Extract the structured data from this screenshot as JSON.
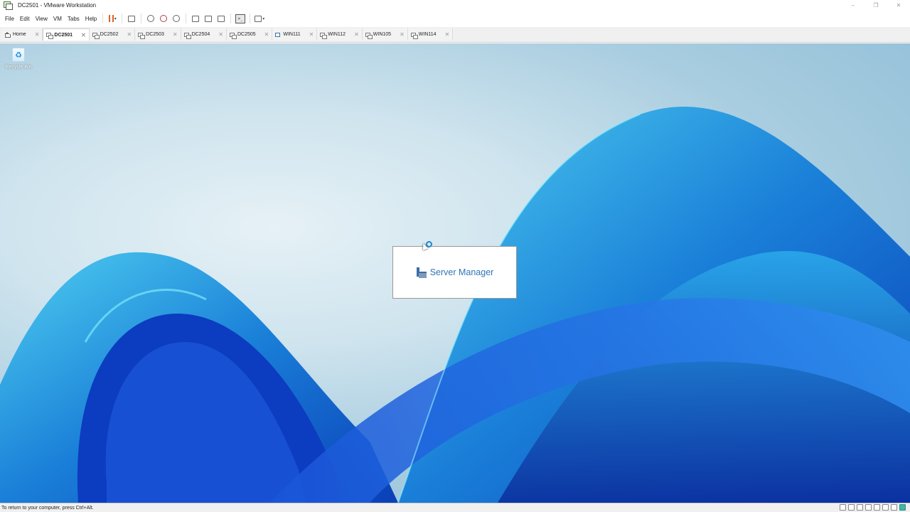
{
  "window": {
    "title": "DC2501 - VMware Workstation",
    "controls": [
      "–",
      "❐",
      "✕"
    ]
  },
  "menu": {
    "items": [
      "File",
      "Edit",
      "View",
      "VM",
      "Tabs",
      "Help"
    ]
  },
  "toolbar": {
    "icons": [
      "pause-icon",
      "send-keys-icon",
      "snapshot-icon",
      "revert-snapshot-icon",
      "snapshot-manager-icon",
      "library-icon",
      "thumbnail-icon",
      "fullscreen-icon",
      "console-view-icon",
      "stretch-icon"
    ],
    "console_glyph": ">_",
    "caret": "▾"
  },
  "tabs": [
    {
      "label": "Home",
      "icon": "home-icon",
      "active": false
    },
    {
      "label": "DC2501",
      "icon": "vm-icon",
      "active": true
    },
    {
      "label": "DC2502",
      "icon": "vm-icon",
      "active": false
    },
    {
      "label": "DC2503",
      "icon": "vm-icon",
      "active": false
    },
    {
      "label": "DC2504",
      "icon": "vm-icon",
      "active": false
    },
    {
      "label": "DC2505",
      "icon": "vm-icon",
      "active": false
    },
    {
      "label": "WIN111",
      "icon": "win-vm-icon",
      "active": false
    },
    {
      "label": "WIN112",
      "icon": "win-vm-icon",
      "active": false
    },
    {
      "label": "WIN105",
      "icon": "vm-icon",
      "active": false
    },
    {
      "label": "WIN114",
      "icon": "vm-icon",
      "active": false
    }
  ],
  "tab_close": "✕",
  "desktop": {
    "recycle_bin_label": "Recycle Bin",
    "recycle_glyph": "♻",
    "splash_title": "Server Manager"
  },
  "status": {
    "text": "To return to your computer, press Ctrl+Alt."
  },
  "colors": {
    "accent_pause": "#e06020",
    "splash_text": "#2e75b6"
  }
}
